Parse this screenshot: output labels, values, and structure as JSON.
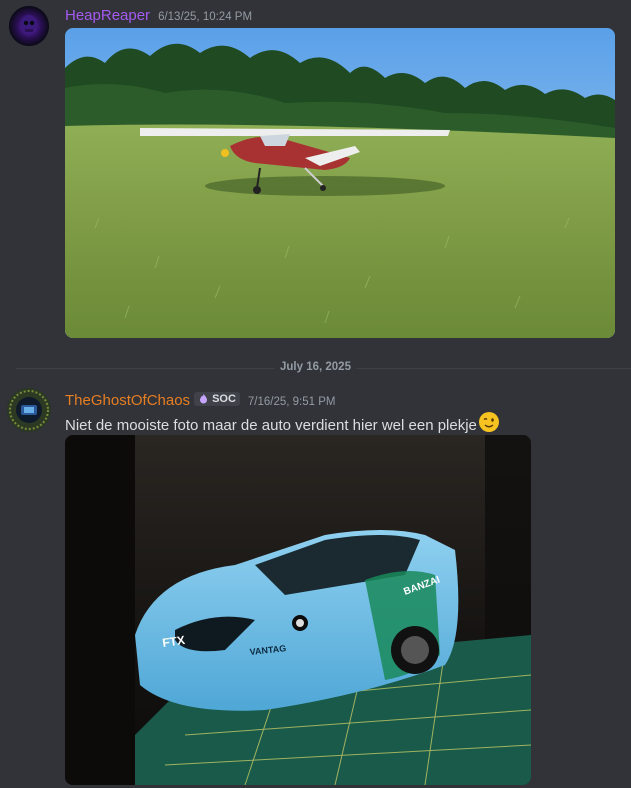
{
  "messages": [
    {
      "username": "HeapReaper",
      "username_color": "#a55af0",
      "timestamp": "6/13/25, 10:24 PM",
      "attachment": "rc-airplane-on-grass-photo"
    },
    {
      "username": "TheGhostOfChaos",
      "username_color": "#e67e22",
      "tag_label": "SOC",
      "timestamp": "7/16/25, 9:51 PM",
      "text": "Niet de mooiste foto maar de auto verdient hier wel een plekje",
      "emoji": "winking-face-emoji",
      "attachment": "rc-drift-car-photo"
    }
  ],
  "date_divider": "July 16, 2025",
  "colors": {
    "background": "#313338",
    "muted_text": "#949ba4",
    "message_text": "#dbdee1"
  }
}
